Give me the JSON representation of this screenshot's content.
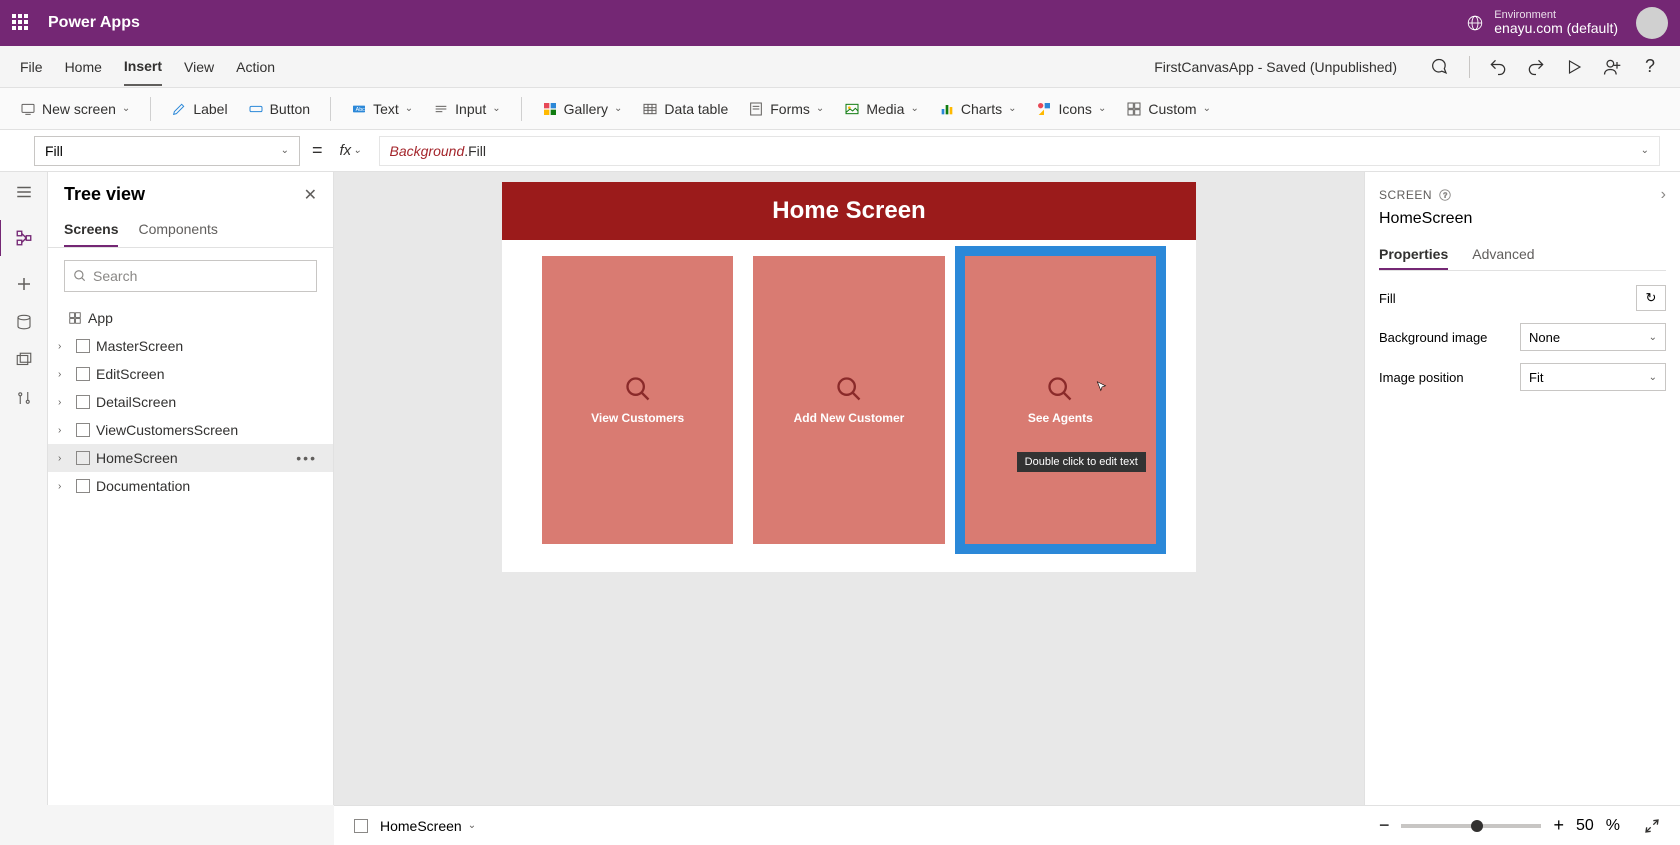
{
  "header": {
    "app_title": "Power Apps",
    "env_label": "Environment",
    "env_name": "enayu.com (default)"
  },
  "menu": {
    "items": [
      "File",
      "Home",
      "Insert",
      "View",
      "Action"
    ],
    "active_index": 2,
    "app_status": "FirstCanvasApp - Saved (Unpublished)"
  },
  "ribbon": {
    "new_screen": "New screen",
    "label": "Label",
    "button": "Button",
    "text": "Text",
    "input": "Input",
    "gallery": "Gallery",
    "data_table": "Data table",
    "forms": "Forms",
    "media": "Media",
    "charts": "Charts",
    "icons": "Icons",
    "custom": "Custom"
  },
  "formula": {
    "property": "Fill",
    "equals": "=",
    "fx": "fx",
    "expr_var": "Background",
    "expr_prop": ".Fill"
  },
  "tree": {
    "title": "Tree view",
    "tabs": [
      "Screens",
      "Components"
    ],
    "active_tab": 0,
    "search_placeholder": "Search",
    "app_label": "App",
    "items": [
      {
        "label": "MasterScreen"
      },
      {
        "label": "EditScreen"
      },
      {
        "label": "DetailScreen"
      },
      {
        "label": "ViewCustomersScreen"
      },
      {
        "label": "HomeScreen",
        "selected": true
      },
      {
        "label": "Documentation"
      }
    ]
  },
  "canvas": {
    "screen_title": "Home Screen",
    "cards": [
      {
        "label": "View Customers"
      },
      {
        "label": "Add New Customer"
      },
      {
        "label": "See Agents",
        "selected": true
      }
    ],
    "tooltip": "Double click to edit text"
  },
  "right": {
    "type": "SCREEN",
    "name": "HomeScreen",
    "tabs": [
      "Properties",
      "Advanced"
    ],
    "active_tab": 0,
    "fill_label": "Fill",
    "bg_image_label": "Background image",
    "bg_image_value": "None",
    "img_pos_label": "Image position",
    "img_pos_value": "Fit"
  },
  "bottom": {
    "screen_name": "HomeScreen",
    "zoom_pct": "50",
    "zoom_unit": "%"
  }
}
